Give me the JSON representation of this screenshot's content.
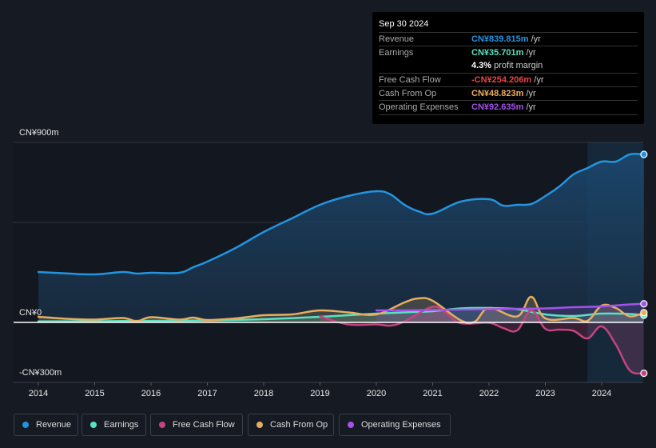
{
  "tooltip": {
    "date": "Sep 30 2024",
    "rows": [
      {
        "label": "Revenue",
        "value": "CN¥839.815m",
        "unit": " /yr",
        "color": "#2394df"
      },
      {
        "label": "Earnings",
        "value": "CN¥35.701m",
        "unit": " /yr",
        "color": "#58e2c2"
      },
      {
        "label": "",
        "value": "4.3%",
        "unit": " profit margin",
        "color": "#ffffff"
      },
      {
        "label": "Free Cash Flow",
        "value": "-CN¥254.206m",
        "unit": " /yr",
        "color": "#ea4545"
      },
      {
        "label": "Cash From Op",
        "value": "CN¥48.823m",
        "unit": " /yr",
        "color": "#eeb060"
      },
      {
        "label": "Operating Expenses",
        "value": "CN¥92.635m",
        "unit": " /yr",
        "color": "#a452ea"
      }
    ]
  },
  "legend": [
    {
      "label": "Revenue",
      "color": "#2394df"
    },
    {
      "label": "Earnings",
      "color": "#58e2c2"
    },
    {
      "label": "Free Cash Flow",
      "color": "#c4447f"
    },
    {
      "label": "Cash From Op",
      "color": "#e8ad5e"
    },
    {
      "label": "Operating Expenses",
      "color": "#a452ea"
    }
  ],
  "chart_data": {
    "type": "area",
    "title": "",
    "xlabel": "",
    "ylabel": "",
    "ylim": [
      -300,
      900
    ],
    "xlim": [
      2013.55,
      2024.85
    ],
    "y_tick_labels": [
      "CN¥900m",
      "CN¥0",
      "-CN¥300m"
    ],
    "y_ticks": [
      900,
      500,
      0,
      -300
    ],
    "x_ticks": [
      2014,
      2015,
      2016,
      2017,
      2018,
      2019,
      2020,
      2021,
      2022,
      2023,
      2024
    ],
    "x_tick_labels": [
      "2014",
      "2015",
      "2016",
      "2017",
      "2018",
      "2019",
      "2020",
      "2021",
      "2022",
      "2023",
      "2024"
    ],
    "highlight_range": [
      2023.75,
      2024.75
    ],
    "grid": true,
    "legend_position": "bottom",
    "units": "CN¥ millions",
    "series": [
      {
        "name": "Revenue",
        "color": "#2394df",
        "x": [
          2014,
          2014.5,
          2015,
          2015.5,
          2015.75,
          2016,
          2016.5,
          2016.75,
          2017,
          2017.5,
          2018,
          2018.5,
          2019,
          2019.5,
          2020,
          2020.25,
          2020.5,
          2020.75,
          2021,
          2021.5,
          2022,
          2022.25,
          2022.5,
          2022.75,
          2023,
          2023.25,
          2023.5,
          2023.75,
          2024,
          2024.25,
          2024.5,
          2024.75
        ],
        "values": [
          252,
          245,
          240,
          252,
          244,
          248,
          248,
          276,
          304,
          372,
          452,
          520,
          588,
          632,
          656,
          640,
          588,
          555,
          544,
          604,
          616,
          584,
          588,
          592,
          632,
          680,
          740,
          772,
          804,
          804,
          840,
          840
        ]
      },
      {
        "name": "Earnings",
        "color": "#58e2c2",
        "x": [
          2014,
          2015,
          2016,
          2017,
          2018,
          2019,
          2019.5,
          2020,
          2020.5,
          2021,
          2021.5,
          2022,
          2022.5,
          2023,
          2023.5,
          2024,
          2024.5,
          2024.75
        ],
        "values": [
          5,
          6,
          8,
          10,
          16,
          28,
          36,
          44,
          50,
          56,
          70,
          72,
          66,
          40,
          32,
          44,
          42,
          36
        ]
      },
      {
        "name": "Free Cash Flow",
        "color": "#c4447f",
        "x": [
          2019,
          2019.5,
          2020,
          2020.25,
          2020.5,
          2021,
          2021.25,
          2021.5,
          2022,
          2022.25,
          2022.5,
          2022.75,
          2023,
          2023.25,
          2023.5,
          2023.75,
          2024,
          2024.25,
          2024.5,
          2024.75
        ],
        "values": [
          30,
          -10,
          -10,
          -16,
          5,
          78,
          44,
          -4,
          -2,
          -28,
          -40,
          60,
          -32,
          -36,
          -42,
          -80,
          -20,
          -110,
          -240,
          -254
        ]
      },
      {
        "name": "Cash From Op",
        "color": "#e8ad5e",
        "x": [
          2014,
          2014.5,
          2015,
          2015.5,
          2015.75,
          2016,
          2016.5,
          2016.75,
          2017,
          2017.5,
          2018,
          2018.5,
          2019,
          2019.5,
          2020,
          2020.5,
          2020.75,
          2021,
          2021.5,
          2021.75,
          2022,
          2022.5,
          2022.75,
          2023,
          2023.5,
          2023.75,
          2024,
          2024.25,
          2024.5,
          2024.75
        ],
        "values": [
          28,
          18,
          14,
          22,
          6,
          26,
          14,
          24,
          12,
          20,
          36,
          40,
          60,
          50,
          40,
          100,
          120,
          108,
          10,
          4,
          72,
          30,
          128,
          20,
          22,
          8,
          84,
          72,
          30,
          49
        ]
      },
      {
        "name": "Operating Expenses",
        "color": "#a452ea",
        "x": [
          2020,
          2020.5,
          2021,
          2021.5,
          2022,
          2022.5,
          2023,
          2023.5,
          2024,
          2024.5,
          2024.75
        ],
        "values": [
          60,
          60,
          62,
          64,
          66,
          68,
          70,
          76,
          80,
          90,
          93
        ]
      }
    ]
  }
}
